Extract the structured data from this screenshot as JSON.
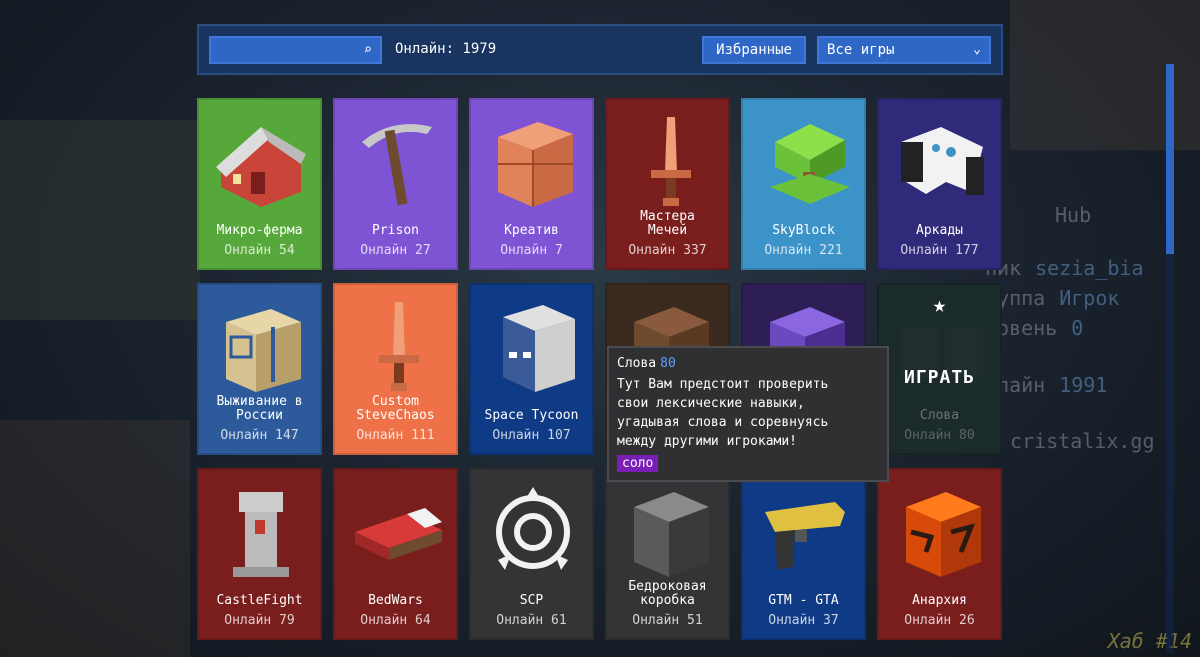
{
  "toolbar": {
    "search_placeholder": "",
    "online_total": "Онлайн: 1979",
    "favorites_label": "Избранные",
    "games_filter": "Все игры"
  },
  "hub": {
    "title": "Hub",
    "rows": [
      {
        "label": "ник",
        "value": "sezia_bia"
      },
      {
        "label": "руппа",
        "value": "Игрок"
      },
      {
        "label": "ровень",
        "value": "0"
      },
      {
        "label": "нлайн",
        "value": "1991"
      },
      {
        "label": "cristalix.gg",
        "value": ""
      }
    ],
    "badge": "Хаб #14"
  },
  "games": [
    {
      "name": "Микро-ферма",
      "online": "Онлайн 54",
      "color": "#56a83a",
      "icon": "house-icon"
    },
    {
      "name": "Prison",
      "online": "Онлайн 27",
      "color": "#7e54d4",
      "icon": "pickaxe-icon"
    },
    {
      "name": "Креатив",
      "online": "Онлайн 7",
      "color": "#7e54d4",
      "icon": "clay-block-icon"
    },
    {
      "name": "Мастера\nМечей",
      "online": "Онлайн 337",
      "color": "#7a1d1d",
      "icon": "sword-icon"
    },
    {
      "name": "SkyBlock",
      "online": "Онлайн 221",
      "color": "#3b93c7",
      "icon": "tree-icon"
    },
    {
      "name": "Аркады",
      "online": "Онлайн 177",
      "color": "#2f2a7a",
      "icon": "gamepad-icon"
    },
    {
      "name": "Выживание в\nРоссии",
      "online": "Онлайн 147",
      "color": "#2d5a9a",
      "icon": "box-icon"
    },
    {
      "name": "Custom\nSteveChaos",
      "online": "Онлайн 111",
      "color": "#ee7148",
      "icon": "sword-icon"
    },
    {
      "name": "Space Tycoon",
      "online": "Онлайн 107",
      "color": "#0f3a86",
      "icon": "steve-head-icon"
    },
    {
      "name": "",
      "online": "",
      "color": "#3a2a1f",
      "icon": "note-block-icon"
    },
    {
      "name": "",
      "online": "",
      "color": "#2d1f55",
      "icon": "chest-icon"
    },
    {
      "name": "Слова",
      "online": "Онлайн 80",
      "color": "#1b2a2a",
      "icon": "letter-blocks-icon"
    },
    {
      "name": "CastleFight",
      "online": "Онлайн 79",
      "color": "#7a1d1d",
      "icon": "tower-icon"
    },
    {
      "name": "BedWars",
      "online": "Онлайн 64",
      "color": "#7a1d1d",
      "icon": "bed-icon"
    },
    {
      "name": "SCP",
      "online": "Онлайн 61",
      "color": "#343436",
      "icon": "scp-logo-icon"
    },
    {
      "name": "Бедроковая\nкоробка",
      "online": "Онлайн 51",
      "color": "#343436",
      "icon": "bedrock-icon"
    },
    {
      "name": "GTM - GTA",
      "online": "Онлайн 37",
      "color": "#0f3a86",
      "icon": "pistol-icon"
    },
    {
      "name": "Анархия",
      "online": "Онлайн 26",
      "color": "#7a1d1d",
      "icon": "magma-block-icon"
    }
  ],
  "hover_card": {
    "star": "★",
    "play_label": "ИГРАТЬ"
  },
  "tooltip": {
    "title": "Слова",
    "count": "80",
    "description": "Тут Вам предстоит проверить\nсвои лексические навыки,\nугадывая слова и соревнуясь\nмежду другими игроками!",
    "badge": "соло"
  }
}
